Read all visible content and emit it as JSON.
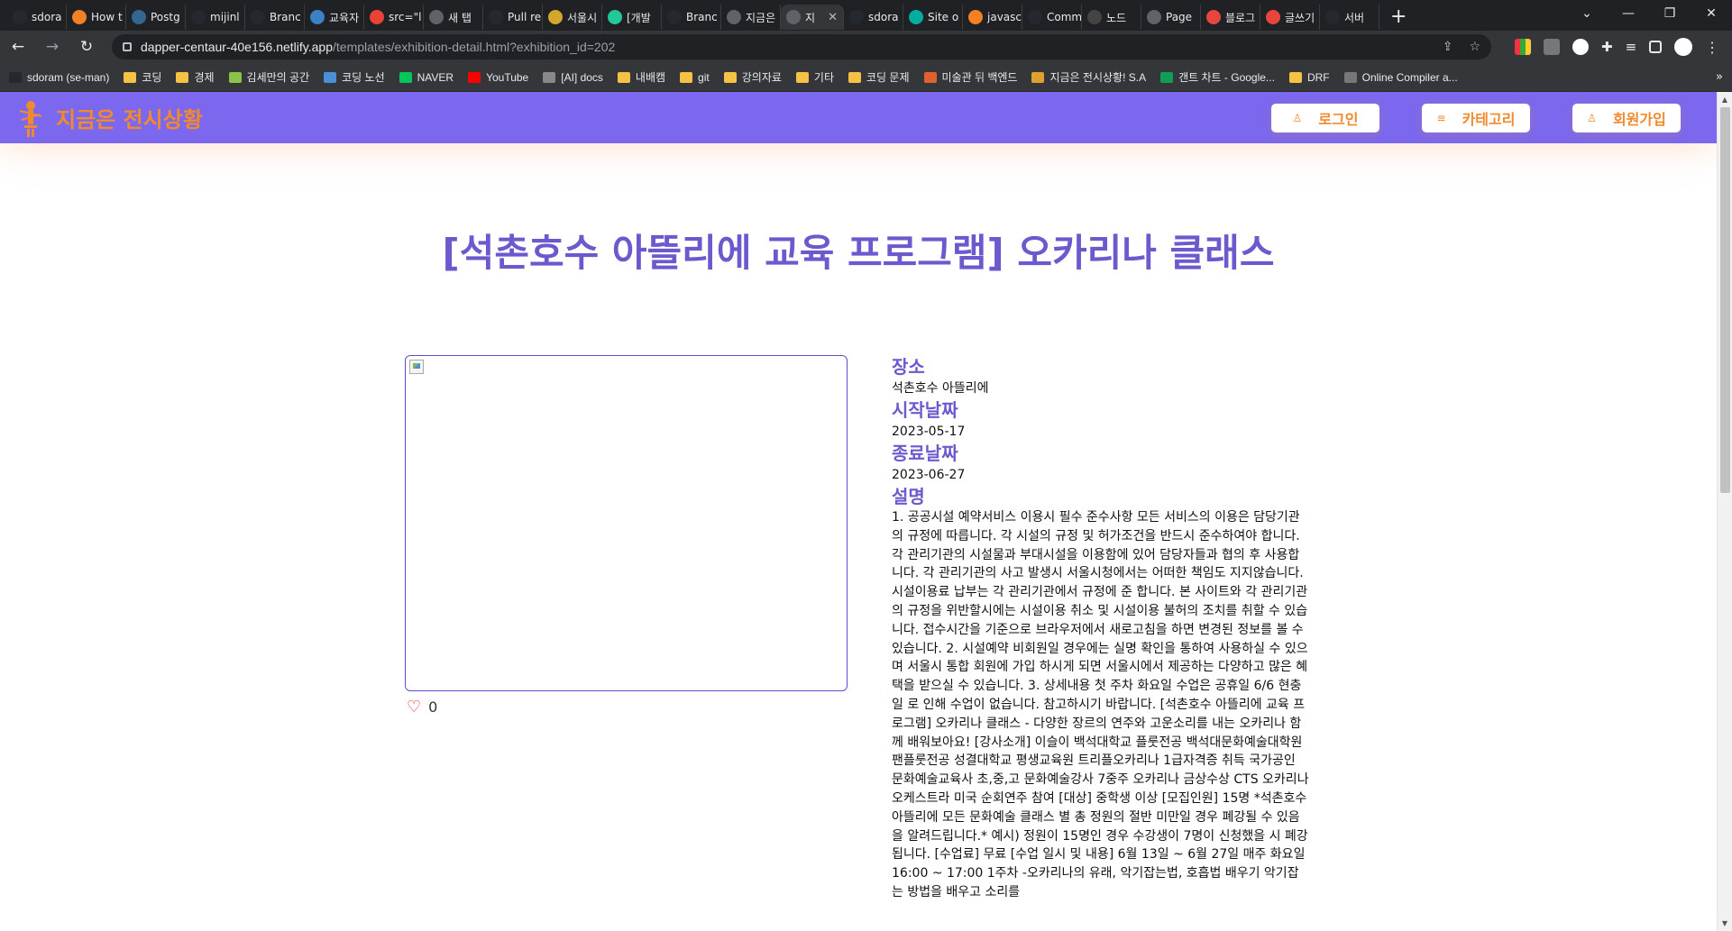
{
  "browser": {
    "tabs": [
      {
        "label": "sdora",
        "color": "#24292f"
      },
      {
        "label": "How t",
        "color": "#f48024"
      },
      {
        "label": "Postg",
        "color": "#336791"
      },
      {
        "label": "mijinl",
        "color": "#24292f"
      },
      {
        "label": "Branc",
        "color": "#24292f"
      },
      {
        "label": "교육자",
        "color": "#3b82c4"
      },
      {
        "label": "src=\"l",
        "color": "#ea4335"
      },
      {
        "label": "새 탭",
        "color": "#5f6368"
      },
      {
        "label": "Pull re",
        "color": "#24292f"
      },
      {
        "label": "서울시",
        "color": "#d4a72c"
      },
      {
        "label": "[개발",
        "color": "#20c997"
      },
      {
        "label": "Branc",
        "color": "#24292f"
      },
      {
        "label": "지금은",
        "color": "#5f6368"
      },
      {
        "label": "지",
        "color": "#5f6368",
        "active": true
      },
      {
        "label": "sdora",
        "color": "#24292f"
      },
      {
        "label": "Site o",
        "color": "#00ad9f"
      },
      {
        "label": "javasc",
        "color": "#f48024"
      },
      {
        "label": "Comm",
        "color": "#24292f"
      },
      {
        "label": "노드",
        "color": "#444"
      },
      {
        "label": "Page",
        "color": "#5f6368"
      },
      {
        "label": "블로그",
        "color": "#e8453c"
      },
      {
        "label": "글쓰기",
        "color": "#e8453c"
      },
      {
        "label": "서버",
        "color": "#24292f"
      }
    ],
    "url_host": "dapper-centaur-40e156.netlify.app",
    "url_path": "/templates/exhibition-detail.html?exhibition_id=202",
    "bookmarks": [
      {
        "label": "sdoram (se-man)",
        "color": "#24292f"
      },
      {
        "label": "코딩",
        "color": "#f6c244"
      },
      {
        "label": "경제",
        "color": "#f6c244"
      },
      {
        "label": "김세만의 공간",
        "color": "#8bc34a"
      },
      {
        "label": "코딩 노선",
        "color": "#4a90d9"
      },
      {
        "label": "NAVER",
        "color": "#03c75a"
      },
      {
        "label": "YouTube",
        "color": "#ff0000"
      },
      {
        "label": "[AI] docs",
        "color": "#888"
      },
      {
        "label": "내배캠",
        "color": "#f6c244"
      },
      {
        "label": "git",
        "color": "#f6c244"
      },
      {
        "label": "강의자료",
        "color": "#f6c244"
      },
      {
        "label": "기타",
        "color": "#f6c244"
      },
      {
        "label": "코딩 문제",
        "color": "#f6c244"
      },
      {
        "label": "미술관 뒤 백엔드",
        "color": "#e06030"
      },
      {
        "label": "지금은 전시상황! S.A",
        "color": "#e0a030"
      },
      {
        "label": "갠트 차트 - Google...",
        "color": "#0f9d58"
      },
      {
        "label": "DRF",
        "color": "#f6c244"
      },
      {
        "label": "Online Compiler a...",
        "color": "#777"
      }
    ]
  },
  "header": {
    "logo_text": "지금은 전시상황",
    "buttons": [
      {
        "label": "로그인",
        "icon": "person-icon"
      },
      {
        "label": "카테고리",
        "icon": "menu-icon"
      },
      {
        "label": "회원가입",
        "icon": "person-icon"
      }
    ]
  },
  "exhibition": {
    "title": "[석촌호수 아뜰리에 교육 프로그램] 오카리나 클래스",
    "like_count": "0",
    "place_label": "장소",
    "place": "석촌호수 아뜰리에",
    "start_label": "시작날짜",
    "start_date": "2023-05-17",
    "end_label": "종료날짜",
    "end_date": "2023-06-27",
    "desc_label": "설명",
    "description": "1. 공공시설 예약서비스 이용시 필수 준수사항 모든 서비스의 이용은 담당기관의 규정에 따릅니다. 각 시설의 규정 및 허가조건을 반드시 준수하여야 합니다. 각 관리기관의 시설물과 부대시설을 이용함에 있어 담당자들과 협의 후 사용합니다. 각 관리기관의 사고 발생시 서울시청에서는 어떠한 책임도 지지않습니다. 시설이용료 납부는 각 관리기관에서 규정에 준 합니다. 본 사이트와 각 관리기관의 규정을 위반할시에는 시설이용 취소 및 시설이용 불허의 조치를 취할 수 있습니다. 접수시간을 기준으로 브라우저에서 새로고침을 하면 변경된 정보를 볼 수 있습니다. 2. 시설예약 비회원일 경우에는 실명 확인을 통하여 사용하실 수 있으며 서울시 통합 회원에 가입 하시게 되면 서울시에서 제공하는 다양하고 많은 혜택을 받으실 수 있습니다. 3. 상세내용 첫 주차 화요일 수업은 공휴일 6/6 현충일 로 인해 수업이 없습니다. 참고하시기 바랍니다. [석촌호수 아뜰리에 교육 프로그램] 오카리나 클래스 - 다양한 장르의 연주와 고운소리를 내는 오카리나 함께 배워보아요!     [강사소개] 이슬이 백석대학교 플룻전공 백석대문화예술대학원 팬플룻전공 성결대학교 평생교육원 트리플오카리나 1급자격증 취득 국가공인 문화예술교육사 초,중,고 문화예술강사 7중주 오카리나 금상수상 CTS 오카리나 오케스트라 미국 순회연주 참여    [대상] 중학생 이상    [모집인원] 15명 *석촌호수 아뜰리에 모든 문화예술 클래스 별 총 정원의 절반 미만일 경우 폐강될 수 있음을 알려드립니다.*    예시) 정원이 15명인 경우 수강생이 7명이 신청했을 시 폐강됩니다.     [수업료] 무료    [수업 일시 및 내용] 6월 13일 ~ 6월  27일 매주 화요일  16:00 ~ 17:00 1주차 -오카리나의 유래, 악기잡는법, 호흡법 배우기 악기잡는 방법을 배우고 소리를"
  }
}
